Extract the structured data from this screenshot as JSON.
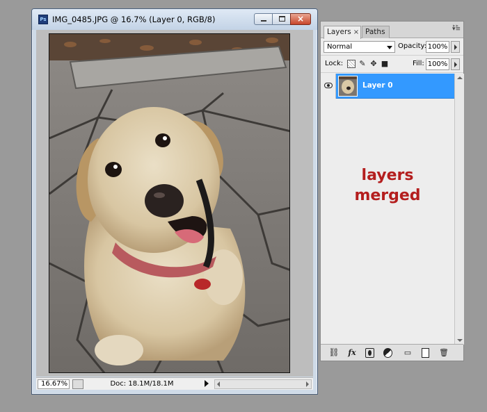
{
  "document": {
    "title": "IMG_0485.JPG @ 16.7% (Layer 0, RGB/8)",
    "icon": "ps-icon",
    "window_buttons": {
      "minimize": "minimize-icon",
      "maximize": "maximize-icon",
      "close": "×"
    }
  },
  "status": {
    "zoom": "16.67%",
    "doc_size": "Doc: 18.1M/18.1M"
  },
  "panel": {
    "tabs": [
      {
        "label": "Layers",
        "active": true,
        "close": "×"
      },
      {
        "label": "Paths",
        "active": false
      }
    ],
    "blend_mode": "Normal",
    "opacity_label": "Opacity:",
    "opacity_value": "100%",
    "lock_label": "Lock:",
    "fill_label": "Fill:",
    "fill_value": "100%",
    "layers": [
      {
        "name": "Layer 0",
        "visible": true,
        "selected": true
      }
    ],
    "selection_color": "#3399ff"
  },
  "annotation": {
    "line1": "layers",
    "line2": "merged",
    "color": "#b41e1e"
  }
}
